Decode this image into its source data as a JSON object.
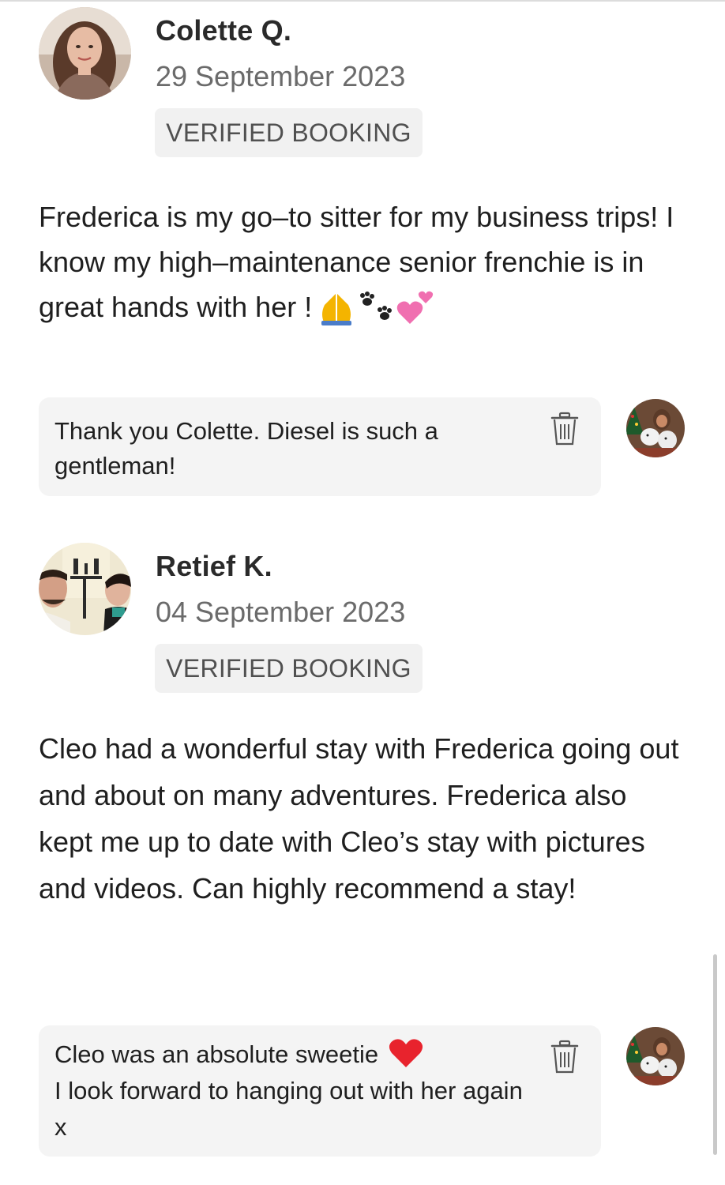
{
  "reviews": [
    {
      "name": "Colette Q.",
      "date": "29 September 2023",
      "badge": "VERIFIED BOOKING",
      "text": "Frederica is my go–to sitter for my business trips! I know my high–maintenance senior frenchie is in great hands with her !",
      "emojis": [
        "folded-hands",
        "paw-prints",
        "two-hearts"
      ],
      "reply": {
        "text": "Thank you Colette. Diesel is such a gentleman!",
        "delete_icon": "trash-icon"
      }
    },
    {
      "name": "Retief K.",
      "date": "04 September 2023",
      "badge": "VERIFIED BOOKING",
      "text": "Cleo had a wonderful stay with Frederica going out and about on many adventures. Frederica also kept me up to date with Cleo’s stay with pictures and videos. Can highly recommend a stay!",
      "reply": {
        "line1": "Cleo was an absolute sweetie",
        "line2": "I look forward to hanging out with her again x",
        "emoji": "red-heart",
        "delete_icon": "trash-icon"
      }
    }
  ],
  "colors": {
    "bubble": "#f4f4f4",
    "badge": "#f1f1f1",
    "date": "#6b6b6b",
    "text": "#1f1f1f"
  }
}
